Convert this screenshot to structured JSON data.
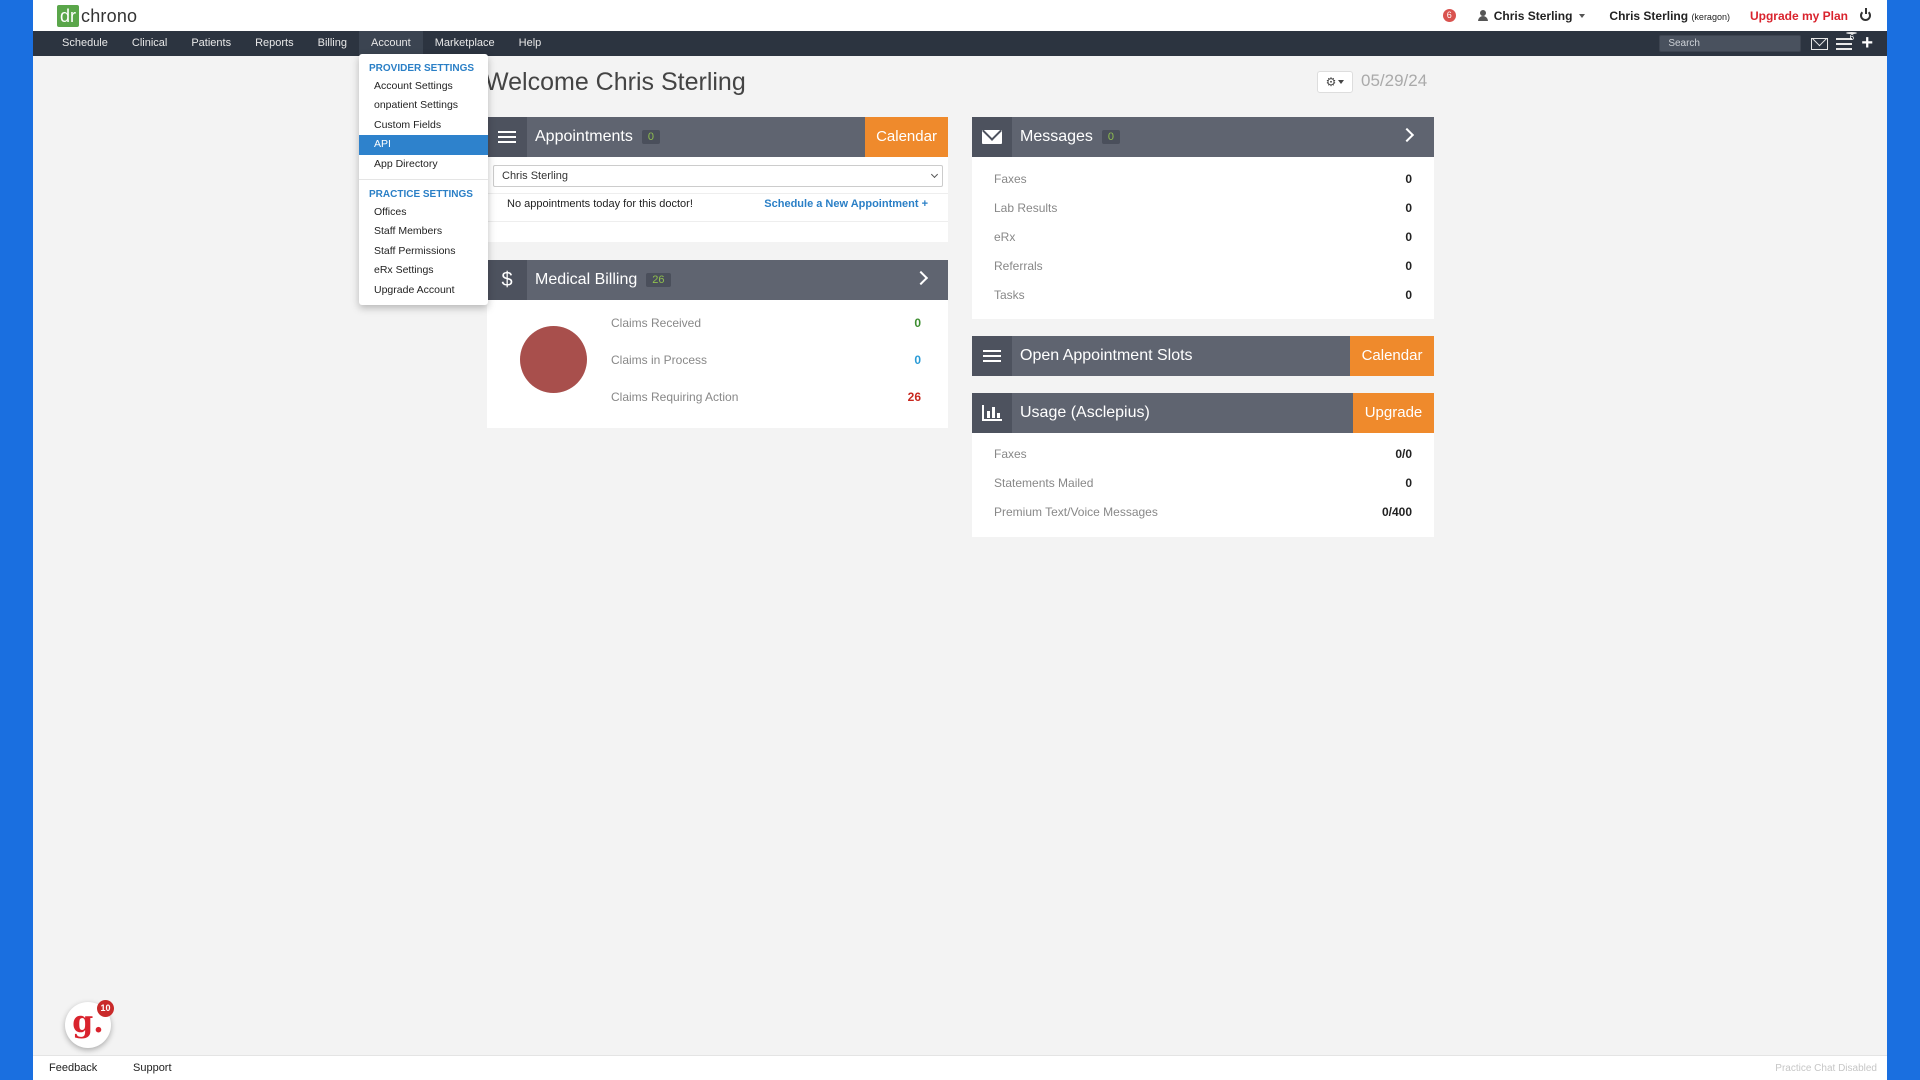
{
  "topbar": {
    "logo_dr": "dr",
    "logo_chrono": "chrono",
    "notification_count": "6",
    "user_name": "Chris Sterling",
    "account_name": "Chris Sterling",
    "account_org": "(keragon)",
    "upgrade_label": "Upgrade my Plan"
  },
  "nav": {
    "items": [
      "Schedule",
      "Clinical",
      "Patients",
      "Reports",
      "Billing",
      "Account",
      "Marketplace",
      "Help"
    ],
    "search_placeholder": "Search",
    "tasks_count": "6"
  },
  "dropdown": {
    "provider_header": "PROVIDER SETTINGS",
    "provider_items": [
      "Account Settings",
      "onpatient Settings",
      "Custom Fields",
      "API",
      "App Directory"
    ],
    "practice_header": "PRACTICE SETTINGS",
    "practice_items": [
      "Offices",
      "Staff Members",
      "Staff Permissions",
      "eRx Settings",
      "Upgrade Account"
    ]
  },
  "main": {
    "welcome": "Welcome Chris Sterling",
    "date": "05/29/24"
  },
  "appointments": {
    "title": "Appointments",
    "count": "0",
    "calendar_label": "Calendar",
    "doctor_selected": "Chris Sterling",
    "empty_text": "No appointments today for this doctor!",
    "schedule_link": "Schedule a New Appointment +"
  },
  "billing": {
    "title": "Medical Billing",
    "count": "26",
    "rows": [
      {
        "label": "Claims Received",
        "value": "0",
        "color": "#3c8d2f"
      },
      {
        "label": "Claims in Process",
        "value": "0",
        "color": "#2a9bd6"
      },
      {
        "label": "Claims Requiring Action",
        "value": "26",
        "color": "#c8281f"
      }
    ]
  },
  "messages": {
    "title": "Messages",
    "count": "0",
    "rows": [
      {
        "label": "Faxes",
        "value": "0"
      },
      {
        "label": "Lab Results",
        "value": "0"
      },
      {
        "label": "eRx",
        "value": "0"
      },
      {
        "label": "Referrals",
        "value": "0"
      },
      {
        "label": "Tasks",
        "value": "0"
      }
    ]
  },
  "open_slots": {
    "title": "Open Appointment Slots",
    "calendar_label": "Calendar"
  },
  "usage": {
    "title": "Usage (Asclepius)",
    "upgrade_label": "Upgrade",
    "rows": [
      {
        "label": "Faxes",
        "value": "0/0"
      },
      {
        "label": "Statements Mailed",
        "value": "0"
      },
      {
        "label": "Premium Text/Voice Messages",
        "value": "0/400"
      }
    ]
  },
  "footer": {
    "feedback": "Feedback",
    "support": "Support",
    "chat_status": "Practice Chat Disabled",
    "chat_badge": "10"
  },
  "colors": {
    "accent_orange": "#ef8a2c",
    "nav_dark": "#2c3440",
    "link_blue": "#2a7fc6",
    "brand_green": "#5aa64a",
    "alert_red": "#d9232d"
  }
}
